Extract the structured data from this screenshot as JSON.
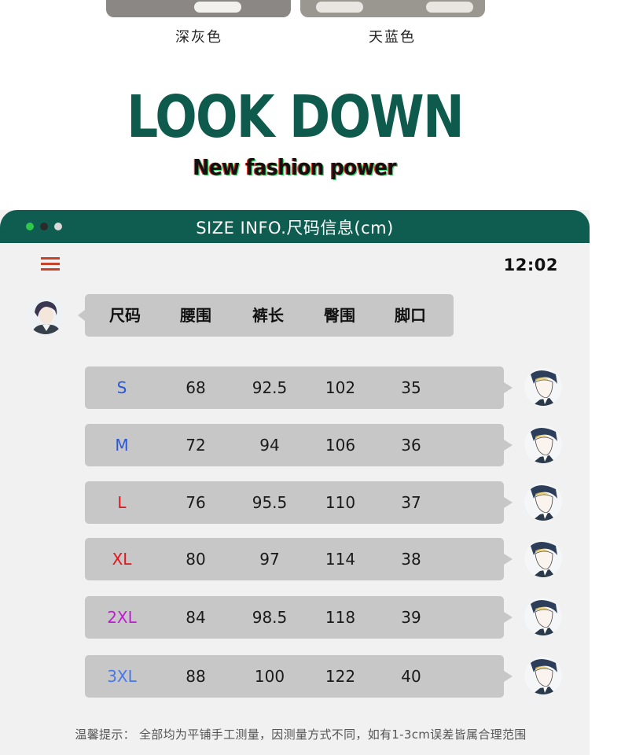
{
  "colors_top": [
    "深灰色",
    "天蓝色"
  ],
  "headline": "LOOK DOWN",
  "tagline": "New fashion power",
  "panel": {
    "title": "SIZE INFO.尺码信息(cm)",
    "time": "12:02",
    "dot_colors": [
      "#2ec84a",
      "#2b2b2b",
      "#d9d9d9"
    ]
  },
  "table": {
    "headers": [
      "尺码",
      "腰围",
      "裤长",
      "臀围",
      "脚口"
    ],
    "rows": [
      {
        "size": "S",
        "color": "#2a57d6",
        "waist": "68",
        "length": "92.5",
        "hip": "102",
        "leg": "35"
      },
      {
        "size": "M",
        "color": "#2a57d6",
        "waist": "72",
        "length": "94",
        "hip": "106",
        "leg": "36"
      },
      {
        "size": "L",
        "color": "#e3141b",
        "waist": "76",
        "length": "95.5",
        "hip": "110",
        "leg": "37"
      },
      {
        "size": "XL",
        "color": "#e3141b",
        "waist": "80",
        "length": "97",
        "hip": "114",
        "leg": "38"
      },
      {
        "size": "2XL",
        "color": "#c21bd6",
        "waist": "84",
        "length": "98.5",
        "hip": "118",
        "leg": "39"
      },
      {
        "size": "3XL",
        "color": "#4a78e6",
        "waist": "88",
        "length": "100",
        "hip": "122",
        "leg": "40"
      }
    ]
  },
  "note": "温馨提示： 全部均为平铺手工测量，因测量方式不同，如有1-3cm误差皆属合理范围"
}
